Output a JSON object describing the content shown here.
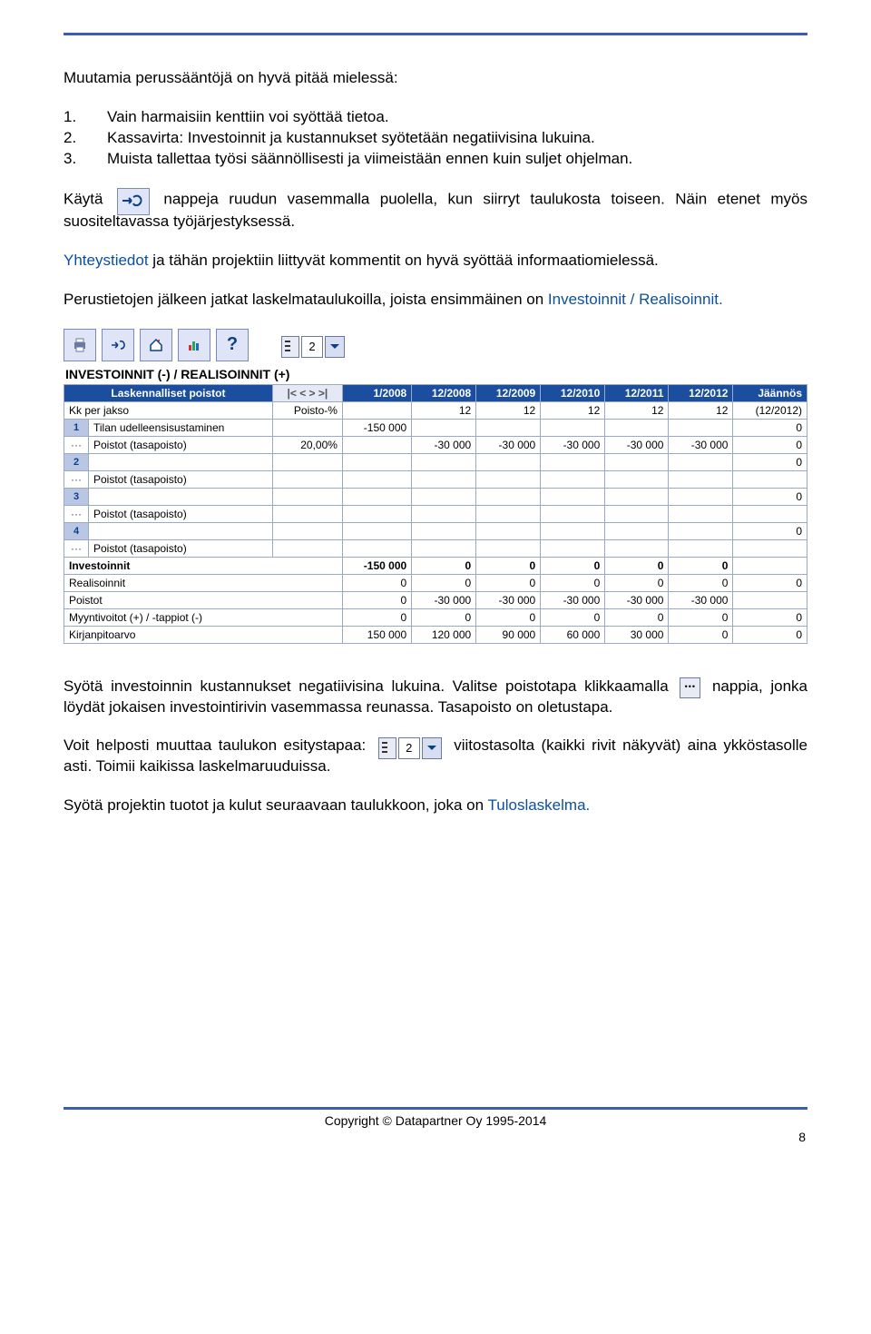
{
  "text": {
    "intro": "Muutamia perussääntöjä on hyvä pitää mielessä:",
    "n1": "1.",
    "li1": "Vain harmaisiin kenttiin voi syöttää tietoa.",
    "n2": "2.",
    "li2": "Kassavirta: Investoinnit ja kustannukset syötetään negatiivisina lukuina.",
    "n3": "3.",
    "li3": "Muista tallettaa työsi säännöllisesti ja viimeistään ennen kuin suljet ohjelman.",
    "p2a": "Käytä",
    "p2b": "nappeja ruudun vasemmalla puolella, kun siirryt taulukosta toiseen. Näin etenet myös suositeltavassa työjärjestyksessä.",
    "p3a": "Yhteystiedot",
    "p3b": " ja tähän projektiin liittyvät kommentit on hyvä syöttää informaatiomielessä.",
    "p4a": "Perustietojen jälkeen jatkat laskelmataulukoilla, joista ensimmäinen on ",
    "p4b": "Investoinnit / Realisoinnit.",
    "p5a": "Syötä investoinnin kustannukset negatiivisina lukuina. Valitse poistotapa klikkaamalla",
    "p5b": "nappia, jonka löydät jokaisen investointirivin vasemmassa reunassa. Tasapoisto on oletustapa.",
    "p6a": "Voit helposti muuttaa taulukon esitystapaa:",
    "p6b": "viitostasolta (kaikki rivit näkyvät) aina ykköstasolle asti. Toimii kaikissa laskelmaruuduissa.",
    "p7a": "Syötä projektin tuotot ja kulut seuraavaan taulukkoon, joka on ",
    "p7b": "Tuloslaskelma.",
    "footer": "Copyright © Datapartner Oy 1995-2014",
    "page": "8"
  },
  "level_value": "2",
  "screenshot": {
    "title": "INVESTOINNIT (-) / REALISOINNIT (+)",
    "col0": "Laskennalliset poistot",
    "nav": "|< < > >|",
    "hdr": [
      "1/2008",
      "12/2008",
      "12/2009",
      "12/2010",
      "12/2011",
      "12/2012",
      "Jäännös"
    ],
    "kk_label": "Kk per jakso",
    "poisto_pct": "Poisto-%",
    "kk": [
      "12",
      "12",
      "12",
      "12",
      "12",
      "(12/2012)"
    ],
    "rows": [
      {
        "idx": "1",
        "name": "Tilan udelleensisustaminen",
        "pct": "",
        "inv": "-150 000",
        "resid": "0"
      },
      {
        "idx": "",
        "name": "Poistot (tasapoisto)",
        "pct": "20,00%",
        "vals": [
          "-30 000",
          "-30 000",
          "-30 000",
          "-30 000",
          "-30 000"
        ],
        "resid": "0"
      },
      {
        "idx": "2",
        "name": "",
        "pct": "",
        "inv": "",
        "resid": "0"
      },
      {
        "idx": "",
        "name": "Poistot (tasapoisto)",
        "pct": "",
        "vals": [
          "",
          "",
          "",
          "",
          "",
          ""
        ],
        "resid": ""
      },
      {
        "idx": "3",
        "name": "",
        "pct": "",
        "inv": "",
        "resid": "0"
      },
      {
        "idx": "",
        "name": "Poistot (tasapoisto)",
        "pct": "",
        "vals": [
          "",
          "",
          "",
          "",
          "",
          ""
        ],
        "resid": ""
      },
      {
        "idx": "4",
        "name": "",
        "pct": "",
        "inv": "",
        "resid": "0"
      },
      {
        "idx": "",
        "name": "Poistot (tasapoisto)",
        "pct": "",
        "vals": [
          "",
          "",
          "",
          "",
          "",
          ""
        ],
        "resid": ""
      }
    ],
    "sum_labels": [
      "Investoinnit",
      "Realisoinnit",
      "Poistot",
      "Myyntivoitot (+) / -tappiot (-)",
      "Kirjanpitoarvo"
    ],
    "sum_values": [
      [
        "-150 000",
        "0",
        "0",
        "0",
        "0",
        "0",
        ""
      ],
      [
        "0",
        "0",
        "0",
        "0",
        "0",
        "0",
        "0"
      ],
      [
        "0",
        "-30 000",
        "-30 000",
        "-30 000",
        "-30 000",
        "-30 000",
        ""
      ],
      [
        "0",
        "0",
        "0",
        "0",
        "0",
        "0",
        "0"
      ],
      [
        "150 000",
        "120 000",
        "90 000",
        "60 000",
        "30 000",
        "0",
        "0"
      ]
    ]
  }
}
